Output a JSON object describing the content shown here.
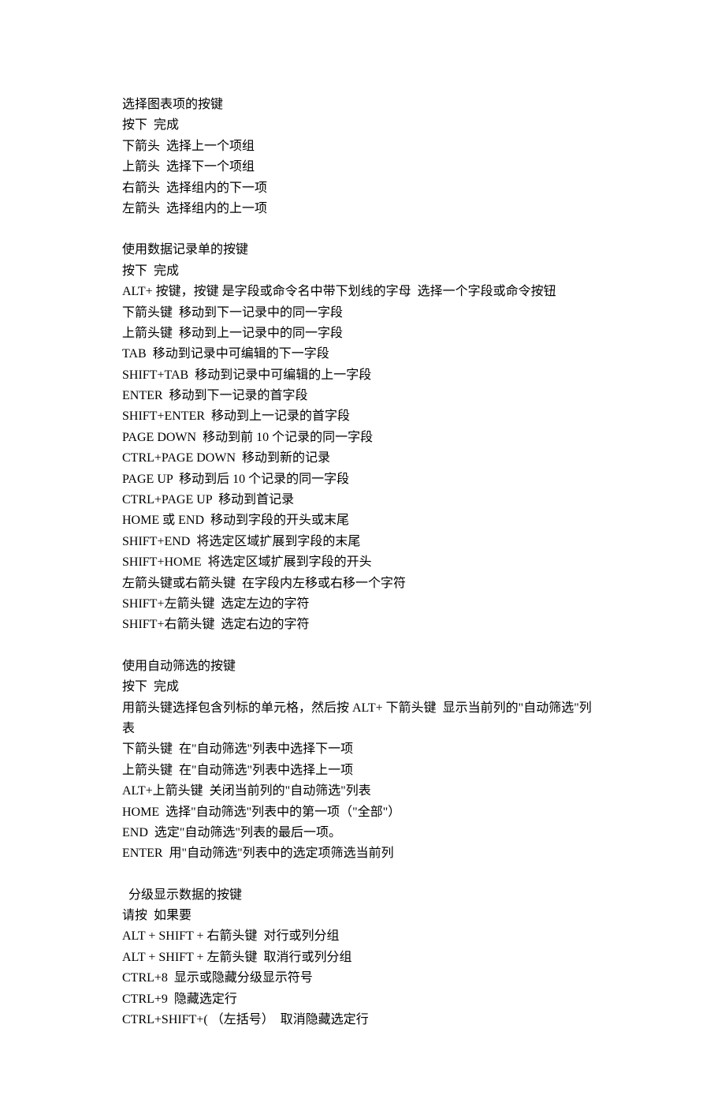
{
  "sections": [
    {
      "lines": [
        "选择图表项的按键",
        "按下  完成",
        "下箭头  选择上一个项组",
        "上箭头  选择下一个项组",
        "右箭头  选择组内的下一项",
        "左箭头  选择组内的上一项"
      ]
    },
    {
      "lines": [
        "使用数据记录单的按键",
        "按下  完成",
        "ALT+ 按键，按键 是字段或命令名中带下划线的字母  选择一个字段或命令按钮",
        "下箭头键  移动到下一记录中的同一字段",
        "上箭头键  移动到上一记录中的同一字段",
        "TAB  移动到记录中可编辑的下一字段",
        "SHIFT+TAB  移动到记录中可编辑的上一字段",
        "ENTER  移动到下一记录的首字段",
        "SHIFT+ENTER  移动到上一记录的首字段",
        "PAGE DOWN  移动到前 10 个记录的同一字段",
        "CTRL+PAGE DOWN  移动到新的记录",
        "PAGE UP  移动到后 10 个记录的同一字段",
        "CTRL+PAGE UP  移动到首记录",
        "HOME 或 END  移动到字段的开头或末尾",
        "SHIFT+END  将选定区域扩展到字段的末尾",
        "SHIFT+HOME  将选定区域扩展到字段的开头",
        "左箭头键或右箭头键  在字段内左移或右移一个字符",
        "SHIFT+左箭头键  选定左边的字符",
        "SHIFT+右箭头键  选定右边的字符"
      ]
    },
    {
      "lines": [
        "使用自动筛选的按键",
        "按下  完成",
        "用箭头键选择包含列标的单元格，然后按 ALT+ 下箭头键  显示当前列的\"自动筛选\"列表",
        "下箭头键  在\"自动筛选\"列表中选择下一项",
        "上箭头键  在\"自动筛选\"列表中选择上一项",
        "ALT+上箭头键  关闭当前列的\"自动筛选\"列表",
        "HOME  选择\"自动筛选\"列表中的第一项（\"全部\"）",
        "END  选定\"自动筛选\"列表的最后一项。",
        "ENTER  用\"自动筛选\"列表中的选定项筛选当前列"
      ]
    },
    {
      "lines": [
        "  分级显示数据的按键",
        "请按  如果要",
        "ALT + SHIFT + 右箭头键  对行或列分组",
        "ALT + SHIFT + 左箭头键  取消行或列分组",
        "CTRL+8  显示或隐藏分级显示符号",
        "CTRL+9  隐藏选定行",
        "CTRL+SHIFT+( （左括号）  取消隐藏选定行"
      ]
    }
  ]
}
